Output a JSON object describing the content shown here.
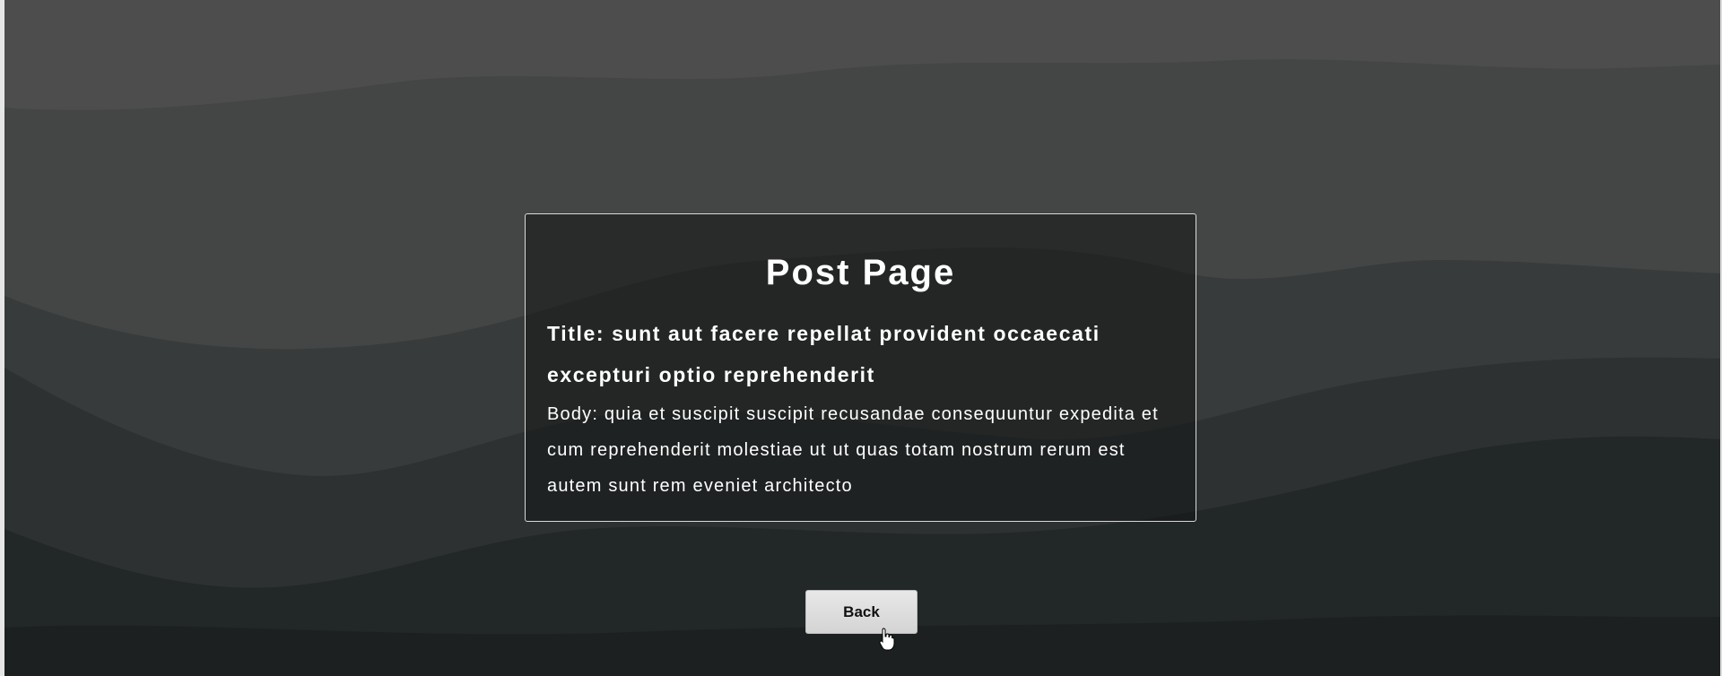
{
  "post": {
    "heading": "Post Page",
    "title_line": "Title: sunt aut facere repellat provident occaecati excepturi optio reprehenderit",
    "body_line": "Body: quia et suscipit suscipit recusandae consequuntur expedita et cum reprehenderit molestiae ut ut quas totam nostrum rerum est autem sunt rem eveniet architecto"
  },
  "actions": {
    "back_label": "Back"
  },
  "colors": {
    "background_top": "#4d4d4d",
    "background_bottom": "#1b1f1f",
    "card_border": "#d9d9d9",
    "text": "#ffffff"
  },
  "icons": {
    "cursor": "hand-pointer-icon"
  }
}
